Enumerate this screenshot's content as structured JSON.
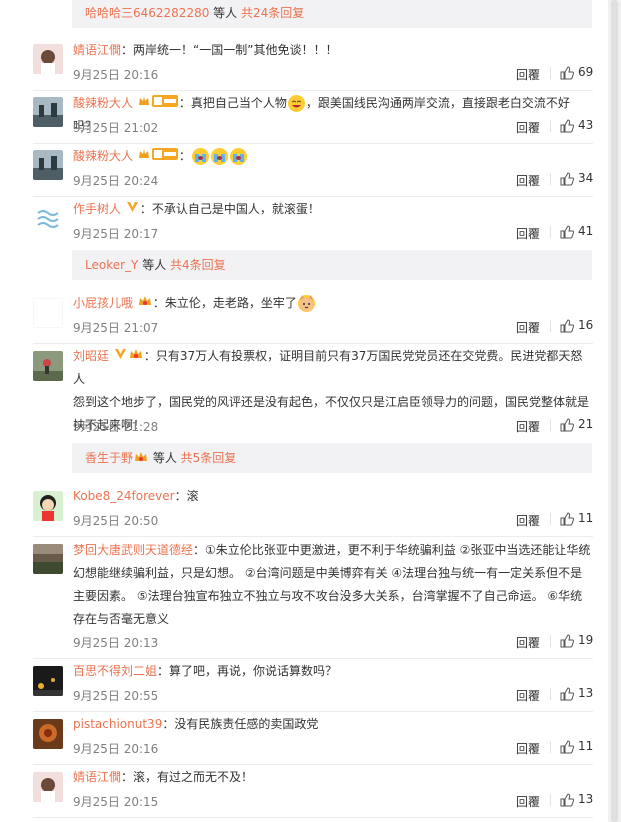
{
  "threads": [
    {
      "user": "哈哈哈三6462282280",
      "suffix": " 等人 ",
      "count": "共24条回复"
    },
    {
      "user": "Leoker_Y",
      "suffix": " 等人 ",
      "count": "共4条回复"
    },
    {
      "user": "香生于野",
      "suffix": " 等人 ",
      "count": "共5条回复"
    }
  ],
  "comments": [
    {
      "name": "婧语江僩",
      "text": "：两岸统一！“一国一制”其他免谈！！！",
      "time": "9月25日 20:16",
      "reply": "回覆",
      "likes": "69"
    },
    {
      "name": "酸辣粉大人",
      "text": "：真把自己当个人物",
      "text2": "，跟美国线民沟通两岸交流，直接跟老白交流不好吗？",
      "time": "9月25日 21:02",
      "reply": "回覆",
      "likes": "43"
    },
    {
      "name": "酸辣粉大人",
      "text": "：",
      "time": "9月25日 20:24",
      "reply": "回覆",
      "likes": "34"
    },
    {
      "name": "作手树人",
      "text": "：不承认自己是中国人，就滚蛋！",
      "time": "9月25日 20:17",
      "reply": "回覆",
      "likes": "41"
    },
    {
      "name": "小屁孩儿哦",
      "text": "：朱立伦，走老路，坐牢了",
      "time": "9月25日 21:07",
      "reply": "回覆",
      "likes": "16"
    },
    {
      "name": "刘昭廷",
      "text": "：只有37万人有投票权，证明目前只有37万国民党党员还在交党费。民进党都天怒人",
      "text_l2": "怨到这个地步了，国民党的风评还是没有起色，不仅仅只是江启臣领导力的问题，国民党整体就是",
      "text_l3": "扶不起来啊！",
      "time": "9月25日 21:28",
      "reply": "回覆",
      "likes": "21"
    },
    {
      "name": "Kobe8_24forever",
      "text": "：滚",
      "time": "9月25日 20:50",
      "reply": "回覆",
      "likes": "11"
    },
    {
      "name": "梦回大唐武则天道德经",
      "text": "：①朱立伦比张亚中更激进，更不利于华统骗利益 ②张亚中当选还能让华统",
      "text_l2": "幻想能继续骗利益，只是幻想。 ②台湾问题是中美博弈有关 ④法理台独与统一有一定关系但不是",
      "text_l3": "主要因素。 ⑤法理台独宣布独立不独立与攻不攻台没多大关系，台湾掌握不了自己命运。 ⑥华统",
      "text_l4": "存在与否毫无意义",
      "time": "9月25日 20:13",
      "reply": "回覆",
      "likes": "19"
    },
    {
      "name": "百思不得刘二姐",
      "text": "：算了吧，再说，你说话算数吗？",
      "time": "9月25日 20:55",
      "reply": "回覆",
      "likes": "13"
    },
    {
      "name": "pistachionut39",
      "text": "：没有民族责任感的卖国政党",
      "time": "9月25日 20:16",
      "reply": "回覆",
      "likes": "11"
    },
    {
      "name": "婧语江僩",
      "text": "：滚，有过之而无不及！",
      "time": "9月25日 20:15",
      "reply": "回覆",
      "likes": "13"
    }
  ],
  "colors": {
    "accent": "#eb7350",
    "meta": "#808080",
    "replybox": "#f2f2f5"
  },
  "icons": {
    "like": "thumbs-up-icon",
    "vip": "crown-badge-icon",
    "verified": "v-verified-icon",
    "emoji": "emoji-icon"
  }
}
